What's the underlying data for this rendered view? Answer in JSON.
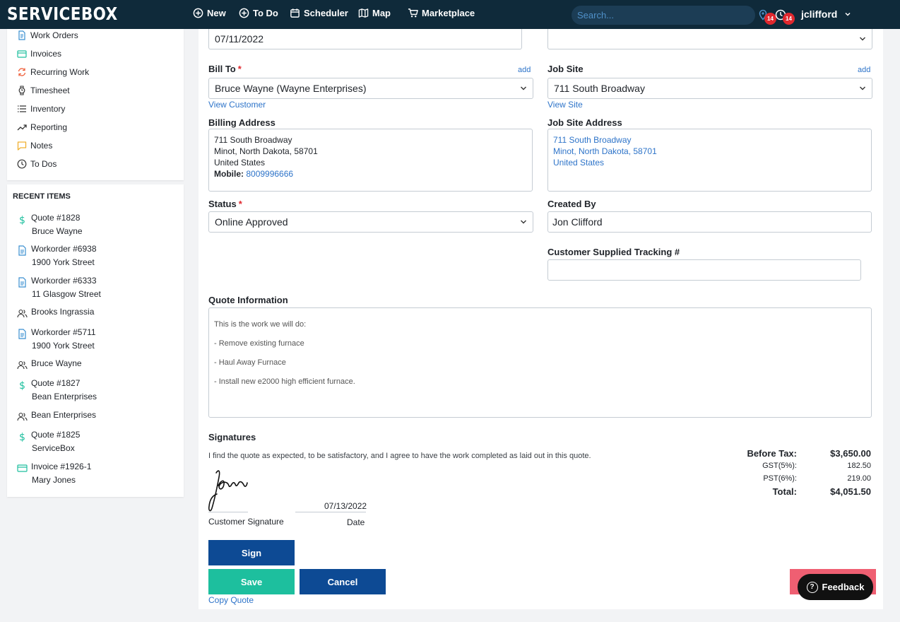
{
  "app": {
    "logo": "SERVICEBOX",
    "nav": [
      {
        "label": "New",
        "icon": "plus-circle-icon"
      },
      {
        "label": "To Do",
        "icon": "plus-circle-icon"
      },
      {
        "label": "Scheduler",
        "icon": "calendar-icon"
      },
      {
        "label": "Map",
        "icon": "map-icon"
      },
      {
        "label": "Marketplace",
        "icon": "cart-icon"
      }
    ],
    "search_placeholder": "Search...",
    "badges": [
      "14",
      "14"
    ],
    "username": "jclifford"
  },
  "sidebar": {
    "menu": [
      {
        "label": "Work Orders",
        "icon": "document-icon"
      },
      {
        "label": "Invoices",
        "icon": "invoice-icon"
      },
      {
        "label": "Recurring Work",
        "icon": "recurring-icon"
      },
      {
        "label": "Timesheet",
        "icon": "watch-icon"
      },
      {
        "label": "Inventory",
        "icon": "list-icon"
      },
      {
        "label": "Reporting",
        "icon": "trend-icon"
      },
      {
        "label": "Notes",
        "icon": "note-icon"
      },
      {
        "label": "To Dos",
        "icon": "clock-icon"
      }
    ],
    "recent_title": "RECENT ITEMS",
    "recent": [
      {
        "title": "Quote #1828",
        "sub": "Bruce Wayne",
        "icon": "dollar-icon"
      },
      {
        "title": "Workorder #6938",
        "sub": "1900 York Street",
        "icon": "document-icon"
      },
      {
        "title": "Workorder #6333",
        "sub": "11 Glasgow Street",
        "icon": "document-icon"
      },
      {
        "title": "Brooks Ingrassia",
        "sub": "",
        "icon": "people-icon"
      },
      {
        "title": "Workorder #5711",
        "sub": "1900 York Street",
        "icon": "document-icon"
      },
      {
        "title": "Bruce Wayne",
        "sub": "",
        "icon": "people-icon"
      },
      {
        "title": "Quote #1827",
        "sub": "Bean Enterprises",
        "icon": "dollar-icon"
      },
      {
        "title": "Bean Enterprises",
        "sub": "",
        "icon": "people-icon"
      },
      {
        "title": "Quote #1825",
        "sub": "ServiceBox",
        "icon": "dollar-icon"
      },
      {
        "title": "Invoice #1926-1",
        "sub": "Mary Jones",
        "icon": "invoice-icon"
      }
    ]
  },
  "form": {
    "date_value": "07/11/2022",
    "bill_to": {
      "label": "Bill To",
      "required": "*",
      "add": "add",
      "value": "Bruce Wayne (Wayne Enterprises)",
      "link": "View Customer"
    },
    "job_site": {
      "label": "Job Site",
      "add": "add",
      "value": "711 South Broadway",
      "link": "View Site"
    },
    "billing_address": {
      "label": "Billing Address",
      "lines": [
        "711 South Broadway",
        "Minot, North Dakota, 58701",
        "United States"
      ],
      "mobile_label": "Mobile:",
      "mobile": "8009996666"
    },
    "job_site_address": {
      "label": "Job Site Address",
      "lines": [
        "711 South Broadway",
        "Minot, North Dakota, 58701",
        "United States"
      ]
    },
    "status": {
      "label": "Status",
      "required": "*",
      "value": "Online Approved"
    },
    "created_by": {
      "label": "Created By",
      "value": "Jon Clifford"
    },
    "tracking": {
      "label": "Customer Supplied Tracking #",
      "value": ""
    },
    "quote_info": {
      "label": "Quote Information",
      "lines": [
        "This is the work we will do:",
        "- Remove existing furnace",
        "- Haul Away Furnace",
        "- Install new e2000 high efficient furnace."
      ]
    },
    "signatures": {
      "label": "Signatures",
      "agreement": "I find the quote as expected, to be satisfactory, and I agree to have the work completed as laid out in this quote.",
      "signature_name": "Jon Clifford",
      "customer_label": "Customer Signature",
      "date_value": "07/13/2022",
      "date_label": "Date"
    },
    "totals": {
      "before_tax_label": "Before Tax:",
      "before_tax": "$3,650.00",
      "gst_label": "GST(5%):",
      "gst": "182.50",
      "pst_label": "PST(6%):",
      "pst": "219.00",
      "total_label": "Total:",
      "total": "$4,051.50"
    },
    "buttons": {
      "sign": "Sign",
      "save": "Save",
      "cancel": "Cancel",
      "copy": "Copy Quote"
    },
    "feedback": "Feedback"
  },
  "colors": {
    "topbar": "#0f2a3a",
    "primary": "#0d4a94",
    "save": "#1dbf9e",
    "link": "#2e74c9",
    "badge": "#e0282e"
  }
}
